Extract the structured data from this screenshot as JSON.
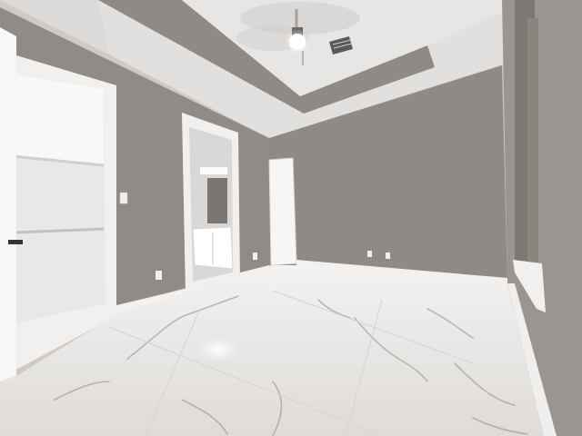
{
  "scene": {
    "colors": {
      "wall": "#8f8a85",
      "wall_light": "#a09b96",
      "ceiling": "#dcdad8",
      "tray": "#8a847f",
      "trim": "#f4f2ef",
      "floor": "#eceae8",
      "vein": "#8e8a86",
      "door": "#f7f7f7",
      "closet_light": "#f6f6f6"
    },
    "icons": [
      "ceiling-fan-icon",
      "air-vent-icon",
      "light-switch-icon",
      "power-outlet-icon"
    ]
  }
}
